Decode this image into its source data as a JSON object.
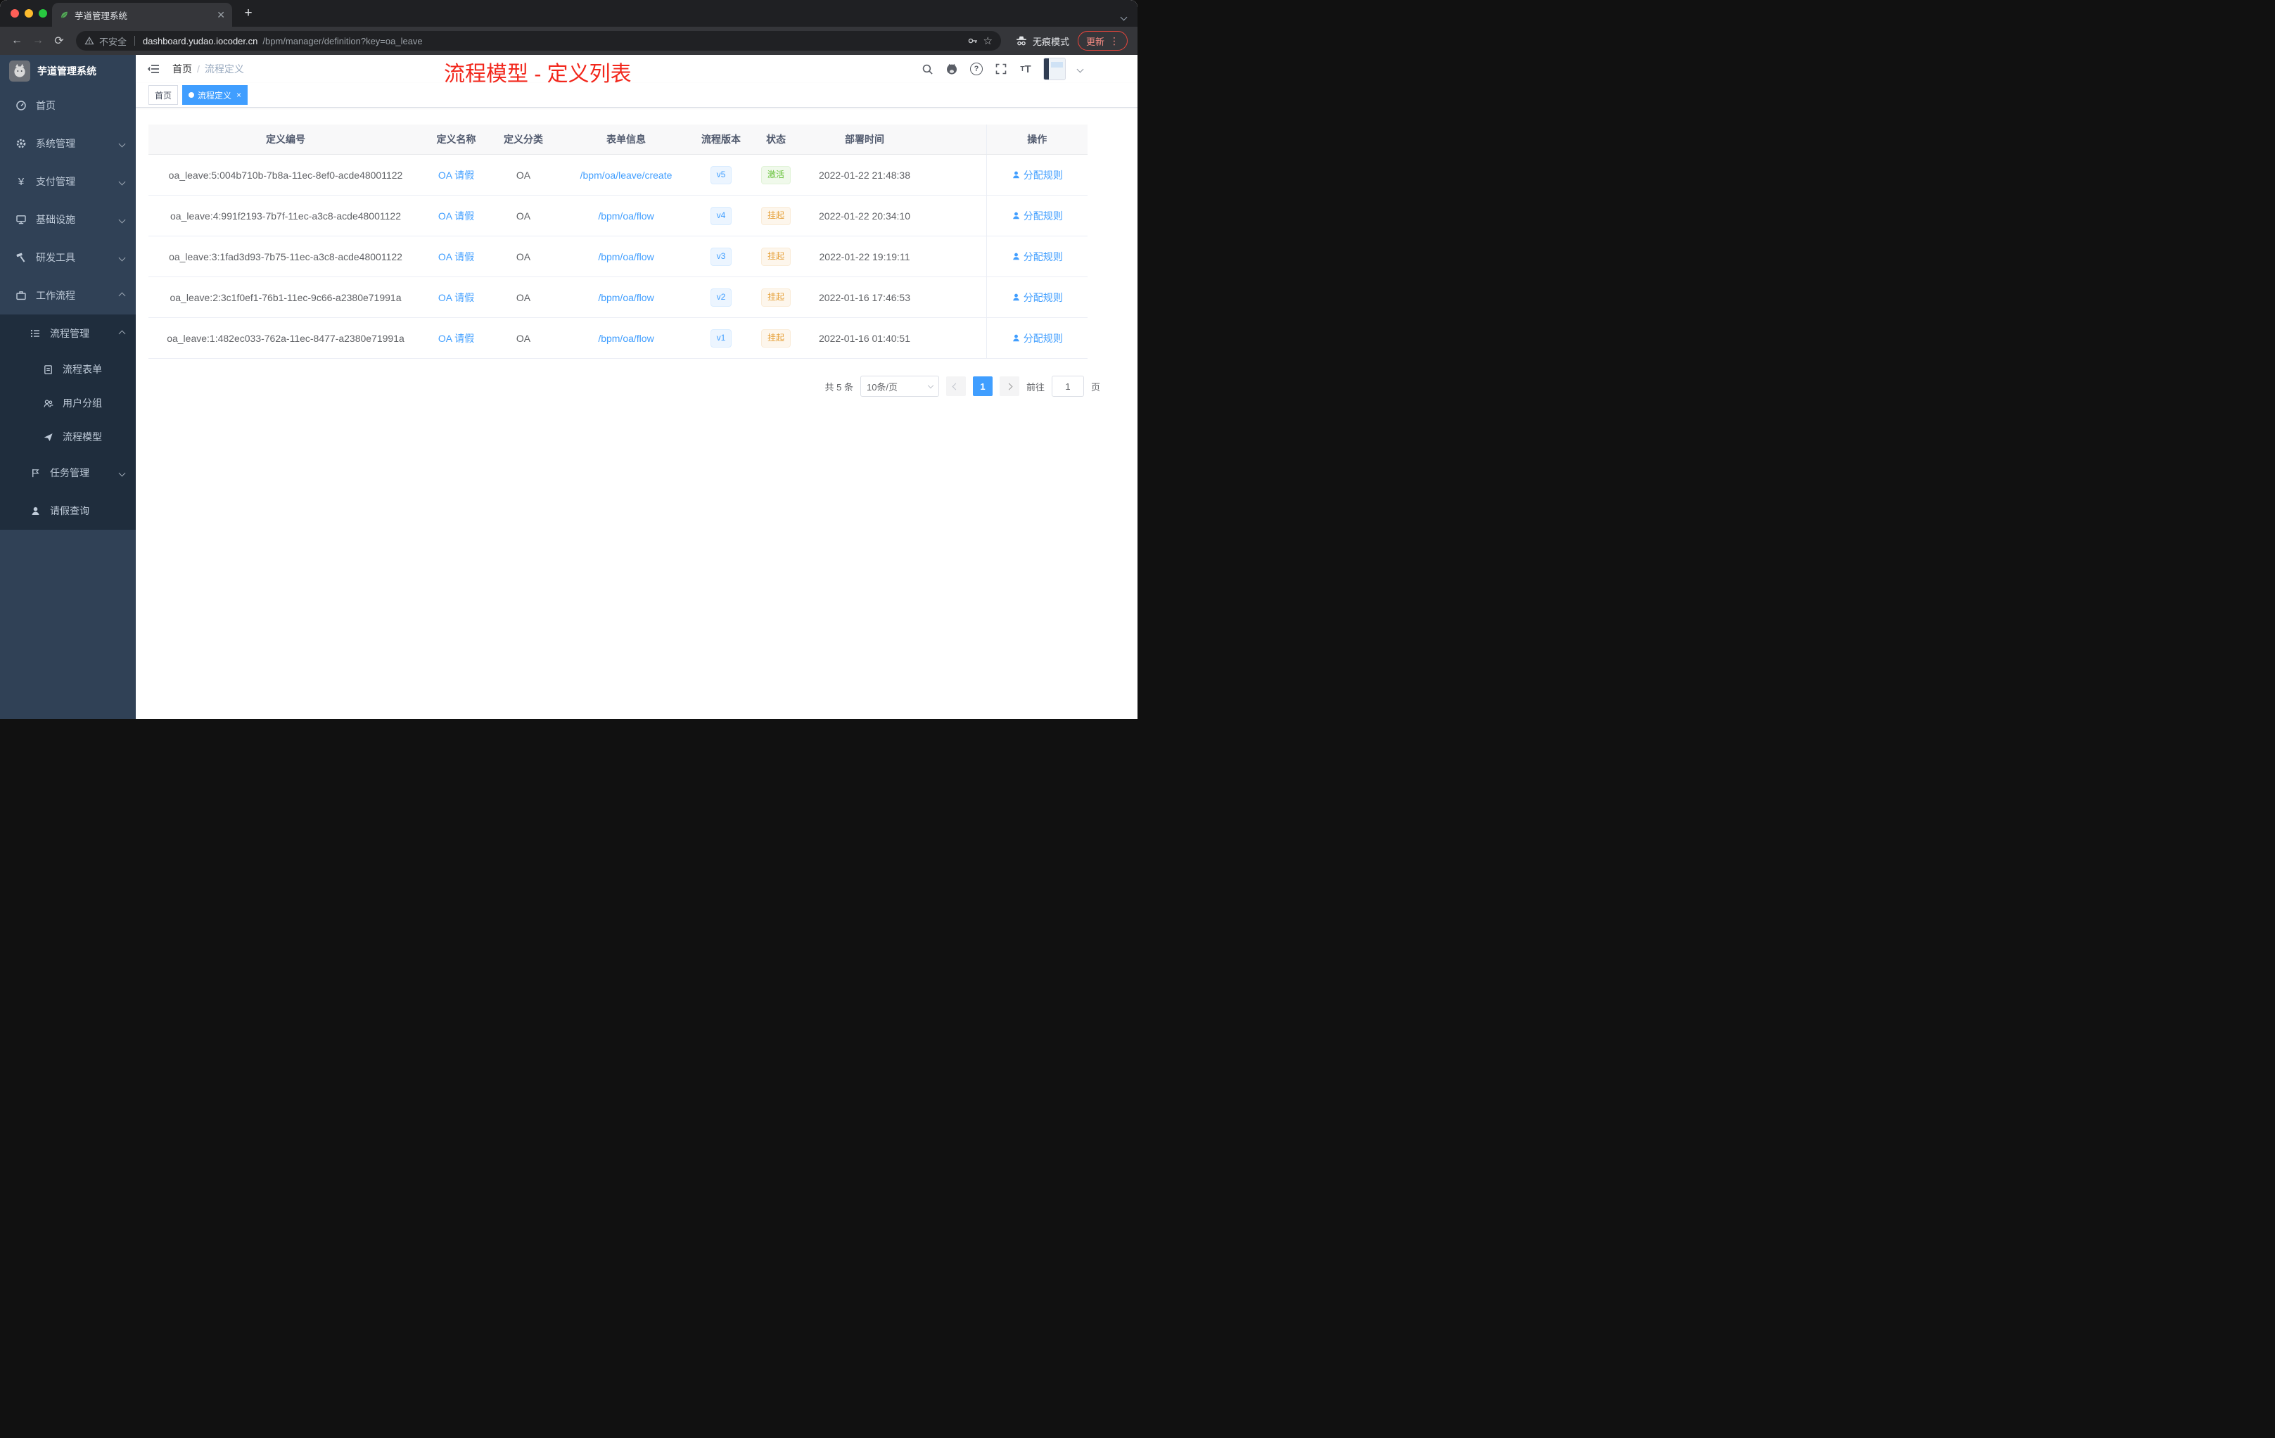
{
  "colors": {
    "accent": "#409eff",
    "success": "#67c23a",
    "warning": "#e6a23c",
    "annotation_red": "#f2271c",
    "sidebar_bg": "#304156",
    "submenu_bg": "#1f2d3d"
  },
  "browser": {
    "tab_title": "芋道管理系统",
    "security_label": "不安全",
    "url_host": "dashboard.yudao.iocoder.cn",
    "url_path": "/bpm/manager/definition?key=oa_leave",
    "incognito_label": "无痕模式",
    "update_label": "更新"
  },
  "sidebar": {
    "logo_title": "芋道管理系统",
    "items": [
      {
        "label": "首页"
      },
      {
        "label": "系统管理"
      },
      {
        "label": "支付管理"
      },
      {
        "label": "基础设施"
      },
      {
        "label": "研发工具"
      },
      {
        "label": "工作流程"
      }
    ],
    "submenu": {
      "process": {
        "label": "流程管理"
      },
      "children": [
        {
          "label": "流程表单"
        },
        {
          "label": "用户分组"
        },
        {
          "label": "流程模型"
        }
      ],
      "task": {
        "label": "任务管理"
      },
      "leave": {
        "label": "请假查询"
      }
    }
  },
  "navbar": {
    "breadcrumb": {
      "home": "首页",
      "separator": "/",
      "current": "流程定义"
    }
  },
  "annotation": "流程模型 - 定义列表",
  "tags": {
    "home": "首页",
    "active": "流程定义",
    "close": "×"
  },
  "table": {
    "columns": [
      "定义编号",
      "定义名称",
      "定义分类",
      "表单信息",
      "流程版本",
      "状态",
      "部署时间",
      "操作"
    ],
    "action_label": "分配规则",
    "rows": [
      {
        "id": "oa_leave:5:004b710b-7b8a-11ec-8ef0-acde48001122",
        "name": "OA 请假",
        "category": "OA",
        "form": "/bpm/oa/leave/create",
        "version": "v5",
        "status": "激活",
        "status_type": "success",
        "time": "2022-01-22 21:48:38"
      },
      {
        "id": "oa_leave:4:991f2193-7b7f-11ec-a3c8-acde48001122",
        "name": "OA 请假",
        "category": "OA",
        "form": "/bpm/oa/flow",
        "version": "v4",
        "status": "挂起",
        "status_type": "warning",
        "time": "2022-01-22 20:34:10"
      },
      {
        "id": "oa_leave:3:1fad3d93-7b75-11ec-a3c8-acde48001122",
        "name": "OA 请假",
        "category": "OA",
        "form": "/bpm/oa/flow",
        "version": "v3",
        "status": "挂起",
        "status_type": "warning",
        "time": "2022-01-22 19:19:11"
      },
      {
        "id": "oa_leave:2:3c1f0ef1-76b1-11ec-9c66-a2380e71991a",
        "name": "OA 请假",
        "category": "OA",
        "form": "/bpm/oa/flow",
        "version": "v2",
        "status": "挂起",
        "status_type": "warning",
        "time": "2022-01-16 17:46:53"
      },
      {
        "id": "oa_leave:1:482ec033-762a-11ec-8477-a2380e71991a",
        "name": "OA 请假",
        "category": "OA",
        "form": "/bpm/oa/flow",
        "version": "v1",
        "status": "挂起",
        "status_type": "warning",
        "time": "2022-01-16 01:40:51"
      }
    ]
  },
  "pagination": {
    "total": "共 5 条",
    "page_size": "10条/页",
    "current_page": "1",
    "goto_label": "前往",
    "goto_value": "1",
    "goto_suffix": "页"
  }
}
